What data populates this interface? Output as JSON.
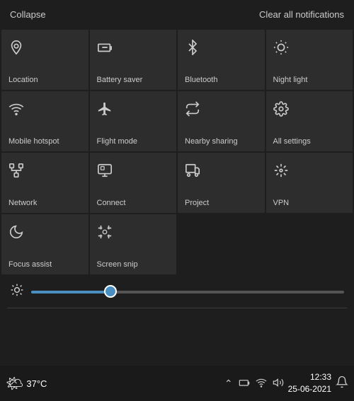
{
  "topBar": {
    "collapse": "Collapse",
    "clearAll": "Clear all notifications"
  },
  "tiles": [
    {
      "id": "location",
      "label": "Location",
      "icon": "📍",
      "active": false,
      "svgIcon": "location"
    },
    {
      "id": "battery-saver",
      "label": "Battery saver",
      "icon": "🔋",
      "active": false,
      "svgIcon": "battery"
    },
    {
      "id": "bluetooth",
      "label": "Bluetooth",
      "icon": "₿",
      "active": false,
      "svgIcon": "bluetooth"
    },
    {
      "id": "night-light",
      "label": "Night light",
      "icon": "🌙",
      "active": false,
      "svgIcon": "night"
    },
    {
      "id": "mobile-hotspot",
      "label": "Mobile hotspot",
      "icon": "📶",
      "active": false,
      "svgIcon": "hotspot"
    },
    {
      "id": "flight-mode",
      "label": "Flight mode",
      "icon": "✈",
      "active": false,
      "svgIcon": "flight"
    },
    {
      "id": "nearby-sharing",
      "label": "Nearby sharing",
      "icon": "⇄",
      "active": false,
      "svgIcon": "nearby"
    },
    {
      "id": "all-settings",
      "label": "All settings",
      "icon": "⚙",
      "active": false,
      "svgIcon": "settings"
    },
    {
      "id": "network",
      "label": "Network",
      "icon": "📡",
      "active": false,
      "svgIcon": "network"
    },
    {
      "id": "connect",
      "label": "Connect",
      "icon": "🖥",
      "active": false,
      "svgIcon": "connect"
    },
    {
      "id": "project",
      "label": "Project",
      "icon": "🖥",
      "active": false,
      "svgIcon": "project"
    },
    {
      "id": "vpn",
      "label": "VPN",
      "icon": "🔀",
      "active": false,
      "svgIcon": "vpn"
    },
    {
      "id": "focus-assist",
      "label": "Focus assist",
      "icon": "🌙",
      "active": false,
      "svgIcon": "focus"
    },
    {
      "id": "screen-snip",
      "label": "Screen snip",
      "icon": "✂",
      "active": false,
      "svgIcon": "snip"
    }
  ],
  "brightness": {
    "value": 25
  },
  "taskbar": {
    "weatherIcon": "🌤",
    "temperature": "37°C",
    "time": "12:33",
    "date": "25-06-2021"
  }
}
